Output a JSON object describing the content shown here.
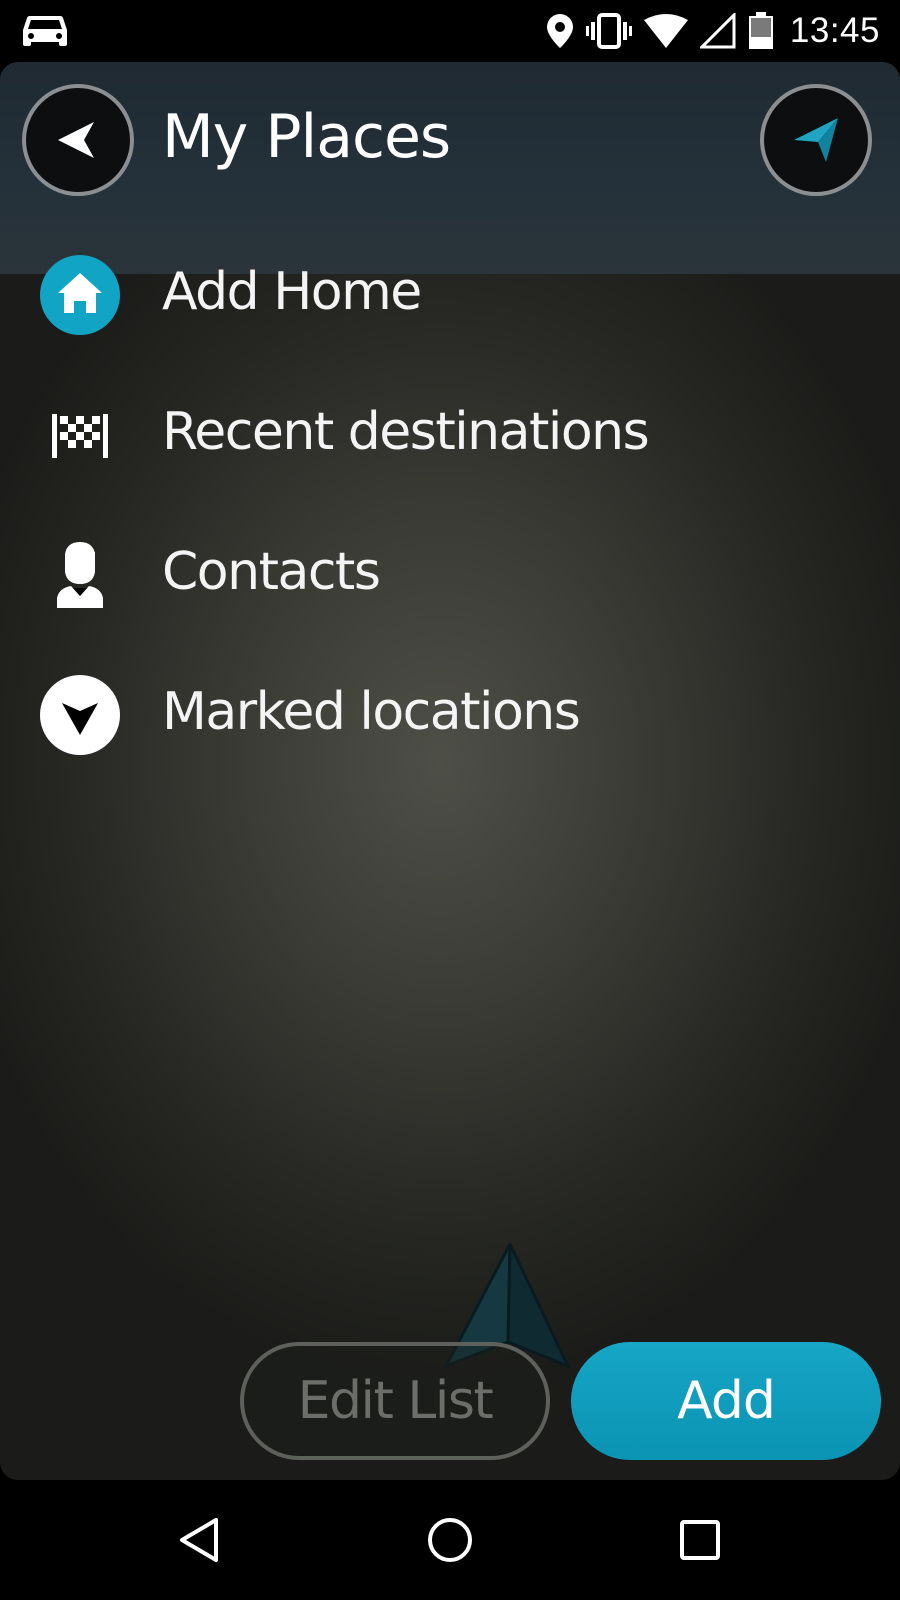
{
  "status_bar": {
    "time": "13:45",
    "icons": [
      "car-icon",
      "location-pin-icon",
      "vibrate-icon",
      "wifi-icon",
      "cell-signal-icon",
      "battery-icon"
    ]
  },
  "header": {
    "title": "My Places",
    "back_icon": "back-arrow-icon",
    "nav_icon": "navigation-arrow-icon"
  },
  "menu": {
    "items": [
      {
        "label": "Add Home",
        "icon": "home-icon"
      },
      {
        "label": "Recent destinations",
        "icon": "checkered-flag-icon"
      },
      {
        "label": "Contacts",
        "icon": "contact-person-icon"
      },
      {
        "label": "Marked locations",
        "icon": "marker-arrow-icon"
      }
    ]
  },
  "actions": {
    "edit_label": "Edit List",
    "add_label": "Add"
  },
  "nav_bar": {
    "icons": [
      "back-triangle-icon",
      "home-circle-icon",
      "recents-square-icon"
    ]
  },
  "colors": {
    "accent": "#0fa0c0",
    "text": "#ffffff",
    "disabled_text": "#6c6e69"
  }
}
